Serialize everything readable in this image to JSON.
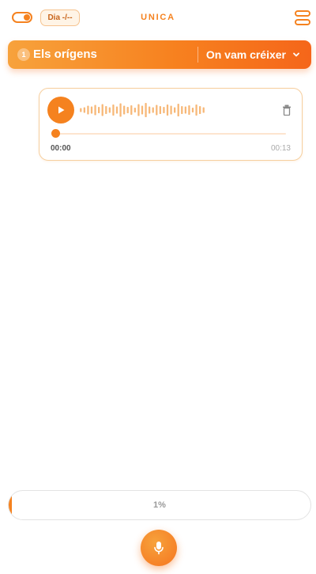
{
  "header": {
    "app_title": "UNICA",
    "day_label": "Dia -/--",
    "theme_toggle_on": true
  },
  "chapter": {
    "number": "1",
    "title": "Els orígens",
    "section": "On vam créixer"
  },
  "audio": {
    "current_time": "00:00",
    "total_time": "00:13",
    "playback_position": 0,
    "waveform": [
      0.25,
      0.35,
      0.55,
      0.45,
      0.65,
      0.4,
      0.75,
      0.5,
      0.35,
      0.7,
      0.45,
      0.85,
      0.55,
      0.4,
      0.6,
      0.3,
      0.75,
      0.55,
      0.9,
      0.45,
      0.35,
      0.65,
      0.5,
      0.4,
      0.7,
      0.55,
      0.35,
      0.8,
      0.5,
      0.45,
      0.6,
      0.3,
      0.7,
      0.5,
      0.35
    ]
  },
  "progress": {
    "label": "1%",
    "value": 0.01
  },
  "colors": {
    "accent": "#f5821f",
    "accent_light": "#f7a23c",
    "accent_dark": "#f5661a"
  }
}
